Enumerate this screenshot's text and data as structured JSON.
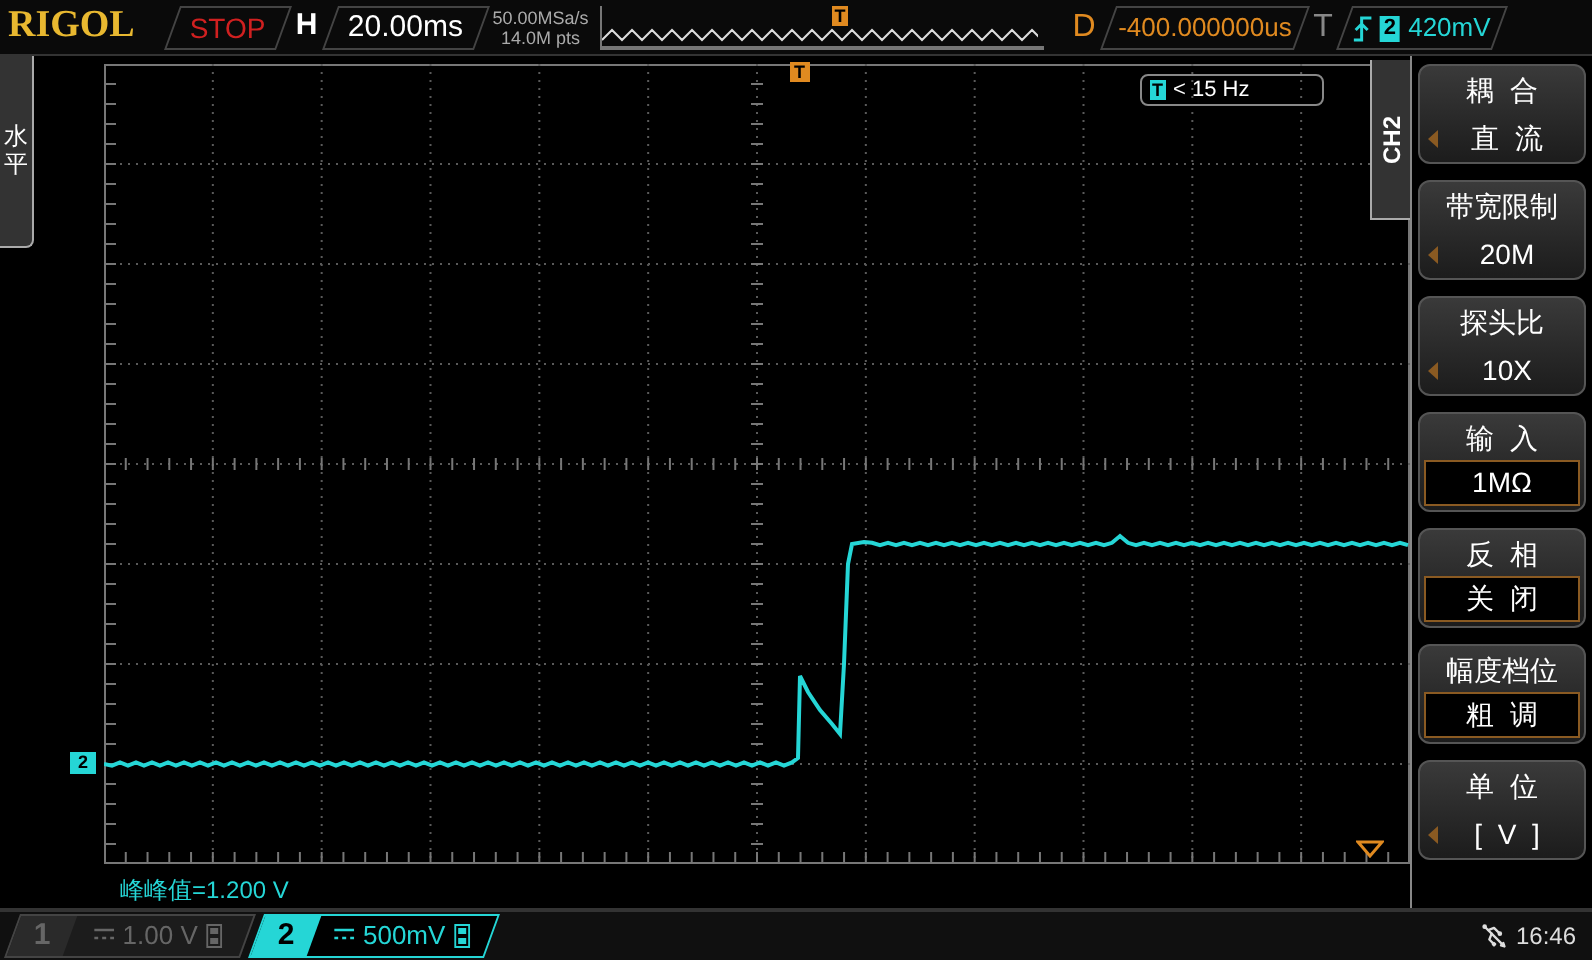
{
  "header": {
    "brand": "RIGOL",
    "run_state": "STOP",
    "timebase_label": "H",
    "timebase": "20.00ms",
    "sample_rate": "50.00MSa/s",
    "memory_depth": "14.0M pts",
    "memory_trigger_marker": "T",
    "delay_label": "D",
    "delay": "-400.000000us",
    "trigger_label": "T",
    "trigger_source": "2",
    "trigger_level": "420mV"
  },
  "horizontal_tab": "水平",
  "screen": {
    "trigger_marker": "T",
    "frequency_badge": {
      "icon": "T",
      "text": "< 15 Hz"
    },
    "channel_marker": "2",
    "measurement": "峰峰值=1.200 V"
  },
  "channel_tab": "CH2",
  "menu": [
    {
      "kind": "select",
      "label": "耦  合",
      "value": "直  流"
    },
    {
      "kind": "select",
      "label": "带宽限制",
      "value": "20M"
    },
    {
      "kind": "select",
      "label": "探头比",
      "value": "10X"
    },
    {
      "kind": "toggle",
      "label": "输  入",
      "value": "1MΩ"
    },
    {
      "kind": "toggle",
      "label": "反  相",
      "value": "关  闭"
    },
    {
      "kind": "toggle",
      "label": "幅度档位",
      "value": "粗  调"
    },
    {
      "kind": "select",
      "label": "单  位",
      "value": "[  V  ]"
    }
  ],
  "channels": [
    {
      "number": "1",
      "scale": "1.00 V",
      "selected": false
    },
    {
      "number": "2",
      "scale": "500mV",
      "selected": true
    }
  ],
  "status": {
    "time": "16:46"
  }
}
